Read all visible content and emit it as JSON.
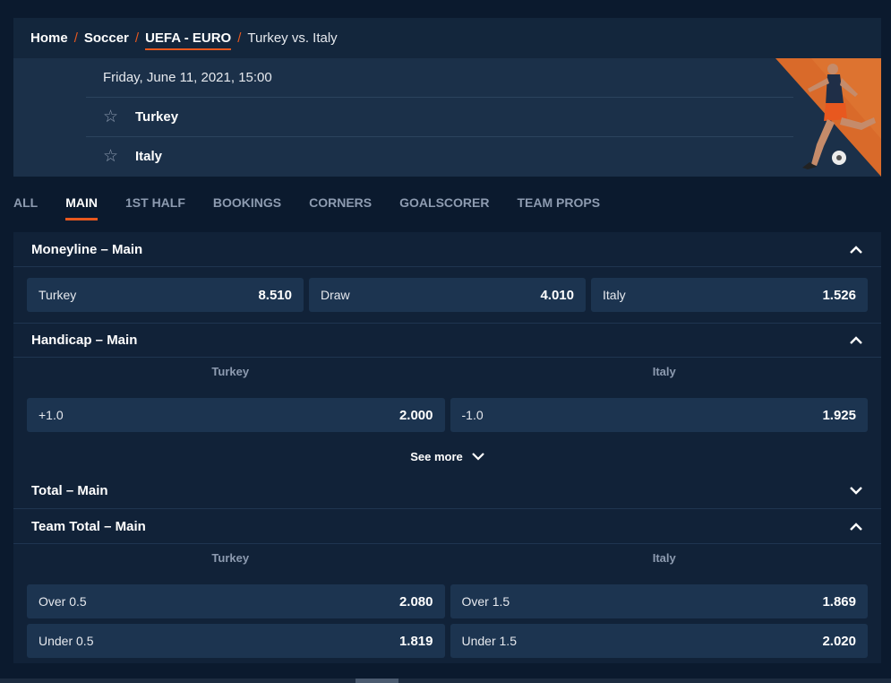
{
  "breadcrumb": {
    "home": "Home",
    "sport": "Soccer",
    "league": "UEFA - EURO",
    "event": "Turkey vs. Italy",
    "separator": "/"
  },
  "match": {
    "datetime": "Friday, June 11, 2021, 15:00",
    "home_team": "Turkey",
    "away_team": "Italy"
  },
  "tabs": [
    "ALL",
    "MAIN",
    "1ST HALF",
    "BOOKINGS",
    "CORNERS",
    "GOALSCORER",
    "TEAM PROPS"
  ],
  "active_tab": "MAIN",
  "markets": {
    "moneyline": {
      "title": "Moneyline – Main",
      "odds": [
        {
          "label": "Turkey",
          "value": "8.510"
        },
        {
          "label": "Draw",
          "value": "4.010"
        },
        {
          "label": "Italy",
          "value": "1.526"
        }
      ]
    },
    "handicap": {
      "title": "Handicap – Main",
      "columns": [
        "Turkey",
        "Italy"
      ],
      "odds": [
        {
          "label": "+1.0",
          "value": "2.000"
        },
        {
          "label": "-1.0",
          "value": "1.925"
        }
      ],
      "see_more": "See more"
    },
    "total": {
      "title": "Total – Main"
    },
    "team_total": {
      "title": "Team Total – Main",
      "columns": [
        "Turkey",
        "Italy"
      ],
      "rows": [
        [
          {
            "label": "Over 0.5",
            "value": "2.080"
          },
          {
            "label": "Over 1.5",
            "value": "1.869"
          }
        ],
        [
          {
            "label": "Under 0.5",
            "value": "1.819"
          },
          {
            "label": "Under 1.5",
            "value": "2.020"
          }
        ]
      ]
    }
  },
  "colors": {
    "accent": "#e8581f",
    "background": "#0b1a2e",
    "panel": "#112238",
    "button": "#1c3450"
  }
}
